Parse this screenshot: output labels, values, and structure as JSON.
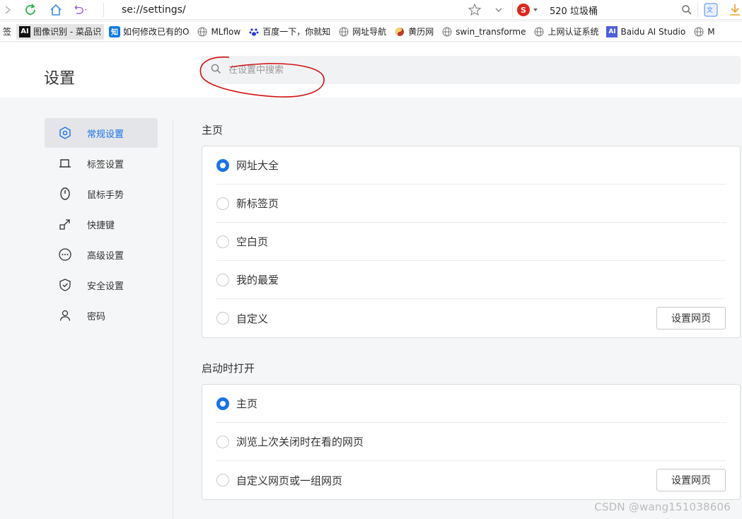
{
  "toolbar": {
    "address": "se://settings/",
    "search_engine_badge": "S",
    "search_engine_text": "520 垃圾桶"
  },
  "bookmarks": [
    {
      "label": "签",
      "icon": "none"
    },
    {
      "label": "图像识别 - 菜品识",
      "icon": "ai-logo-icon",
      "badge": "AI",
      "active": true
    },
    {
      "label": "如何修改已有的O",
      "icon": "zhihu-icon",
      "badge": "知"
    },
    {
      "label": "MLflow",
      "icon": "globe-icon"
    },
    {
      "label": "百度一下，你就知",
      "icon": "baidu-paw-icon"
    },
    {
      "label": "网址导航",
      "icon": "globe-icon"
    },
    {
      "label": "黄历网",
      "icon": "yin-yang-icon"
    },
    {
      "label": "swin_transforme",
      "icon": "globe-icon"
    },
    {
      "label": "上网认证系统",
      "icon": "globe-icon"
    },
    {
      "label": "Baidu AI Studio",
      "icon": "aistudio-icon",
      "badge": "AI"
    },
    {
      "label": "M",
      "icon": "globe-icon"
    }
  ],
  "header": {
    "title": "设置",
    "search_placeholder": "在设置中搜索"
  },
  "sidebar": {
    "items": [
      {
        "label": "常规设置",
        "icon": "hexagon-settings-icon",
        "active": true
      },
      {
        "label": "标签设置",
        "icon": "tab-icon"
      },
      {
        "label": "鼠标手势",
        "icon": "mouse-icon"
      },
      {
        "label": "快捷键",
        "icon": "shortcut-arrow-icon"
      },
      {
        "label": "高级设置",
        "icon": "more-circle-icon"
      },
      {
        "label": "安全设置",
        "icon": "shield-icon"
      },
      {
        "label": "密码",
        "icon": "user-icon"
      }
    ]
  },
  "homepage": {
    "title": "主页",
    "options": [
      "网址大全",
      "新标签页",
      "空白页",
      "我的最爱",
      "自定义"
    ],
    "selected_index": 0,
    "button_label": "设置网页"
  },
  "startup": {
    "title": "启动时打开",
    "options": [
      "主页",
      "浏览上次关闭时在看的网页",
      "自定义网页或一组网页"
    ],
    "selected_index": 0,
    "button_label": "设置网页"
  },
  "watermark": "CSDN @wang151038606",
  "colors": {
    "accent": "#1a73e8",
    "annotation": "#d01010"
  }
}
